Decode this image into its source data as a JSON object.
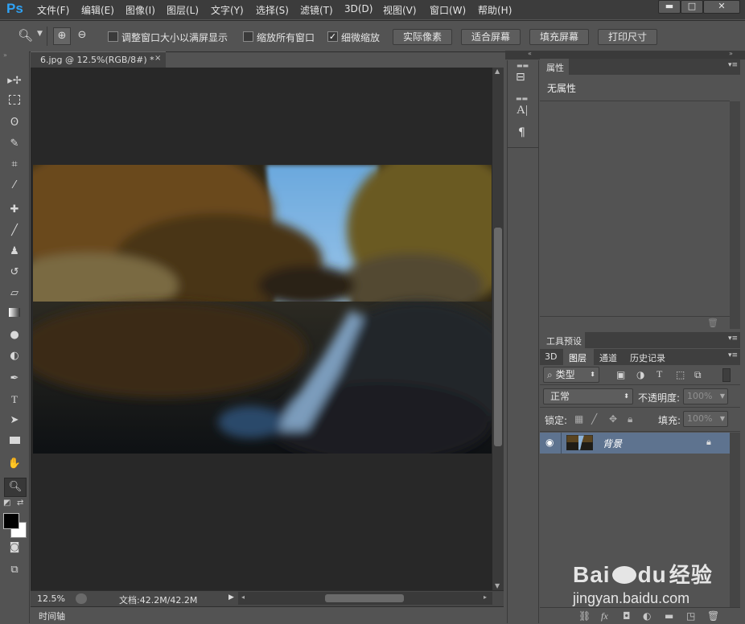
{
  "app": {
    "logo": "Ps"
  },
  "menu": [
    "文件(F)",
    "编辑(E)",
    "图像(I)",
    "图层(L)",
    "文字(Y)",
    "选择(S)",
    "滤镜(T)",
    "3D(D)",
    "视图(V)",
    "窗口(W)",
    "帮助(H)"
  ],
  "window_buttons": {
    "minimize": "▬",
    "restore": "□",
    "close": "✕"
  },
  "options_bar": {
    "tool_icon": "zoom-icon",
    "chk_resize_windows": {
      "label": "调整窗口大小以满屏显示",
      "checked": false
    },
    "chk_zoom_all": {
      "label": "缩放所有窗口",
      "checked": false
    },
    "chk_scrubby": {
      "label": "细微缩放",
      "checked": true
    },
    "btn_actual": "实际像素",
    "btn_fit": "适合屏幕",
    "btn_fill": "填充屏幕",
    "btn_print": "打印尺寸"
  },
  "tools": [
    "move-icon",
    "marquee-icon",
    "lasso-icon",
    "quick-select-icon",
    "crop-icon",
    "eyedropper-icon",
    "healing-icon",
    "brush-icon",
    "stamp-icon",
    "history-brush-icon",
    "eraser-icon",
    "gradient-icon",
    "blur-icon",
    "dodge-icon",
    "pen-icon",
    "type-icon",
    "path-select-icon",
    "rectangle-icon",
    "hand-icon",
    "zoom-icon"
  ],
  "document": {
    "tab_title": "6.jpg @ 12.5%(RGB/8#) *",
    "zoom": "12.5%",
    "doc_info": "文档:42.2M/42.2M",
    "timeline_label": "时间轴"
  },
  "properties": {
    "tab": "属性",
    "content": "无属性"
  },
  "tool_presets": {
    "tab": "工具预设"
  },
  "layers": {
    "tabs": [
      "3D",
      "图层",
      "通道",
      "历史记录"
    ],
    "active_tab": "图层",
    "filter_kind": "类型",
    "blend_mode": "正常",
    "opacity_label": "不透明度:",
    "opacity_value": "100%",
    "lock_label": "锁定:",
    "fill_label": "填充:",
    "fill_value": "100%",
    "layer_name": "背景"
  },
  "watermark": {
    "brand": "Bai",
    "brand_mid": "du",
    "brand_cn": "经验",
    "url": "jingyan.baidu.com"
  },
  "colors": {
    "accent_blue": "#2fa3f6",
    "selected_layer": "#5e738f",
    "panel_bg": "#535353",
    "canvas_bg": "#282828"
  }
}
